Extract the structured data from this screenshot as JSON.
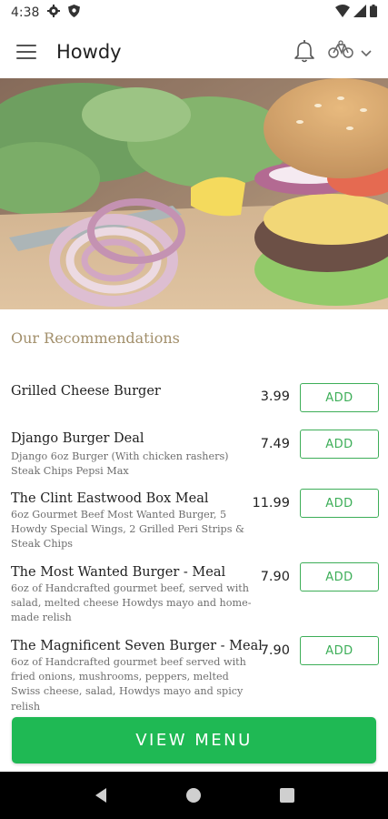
{
  "status_bar": {
    "time": "4:38",
    "icons": [
      "gear-icon",
      "shield-icon",
      "wifi-icon",
      "signal-icon",
      "battery-icon"
    ]
  },
  "app_bar": {
    "title": "Howdy",
    "icons": [
      "menu-icon",
      "bell-icon",
      "bicycle-icon",
      "chevron-down-icon"
    ]
  },
  "hero": {
    "image": "burger-photo"
  },
  "recommendations": {
    "title": "Our Recommendations",
    "items": [
      {
        "name": "Grilled Cheese Burger",
        "description": "",
        "price": "3.99",
        "add_label": "ADD"
      },
      {
        "name": "Django Burger Deal",
        "description": "Django 6oz Burger (With chicken rashers)  Steak Chips  Pepsi Max",
        "price": "7.49",
        "add_label": "ADD"
      },
      {
        "name": "The Clint Eastwood Box Meal",
        "description": "6oz Gourmet Beef Most Wanted Burger, 5 Howdy Special Wings, 2 Grilled Peri Strips & Steak Chips",
        "price": "11.99",
        "add_label": "ADD"
      },
      {
        "name": "The Most Wanted Burger - Meal",
        "description": "6oz of Handcrafted gourmet beef, served with salad, melted cheese Howdys mayo and home-made relish",
        "price": "7.90",
        "add_label": "ADD"
      },
      {
        "name": "The Magnificent Seven Burger - Meal",
        "description": "6oz of Handcrafted gourmet beef served with fried onions, mushrooms, peppers, melted Swiss cheese, salad, Howdys mayo and spicy relish",
        "price": "7.90",
        "add_label": "ADD"
      }
    ]
  },
  "view_menu_label": "VIEW MENU",
  "nav_bar": {
    "icons": [
      "back-icon",
      "home-icon",
      "recents-icon"
    ]
  },
  "colors": {
    "accent_green": "#1fb954",
    "add_green": "#3dae58",
    "section_title": "#a28f6b"
  }
}
